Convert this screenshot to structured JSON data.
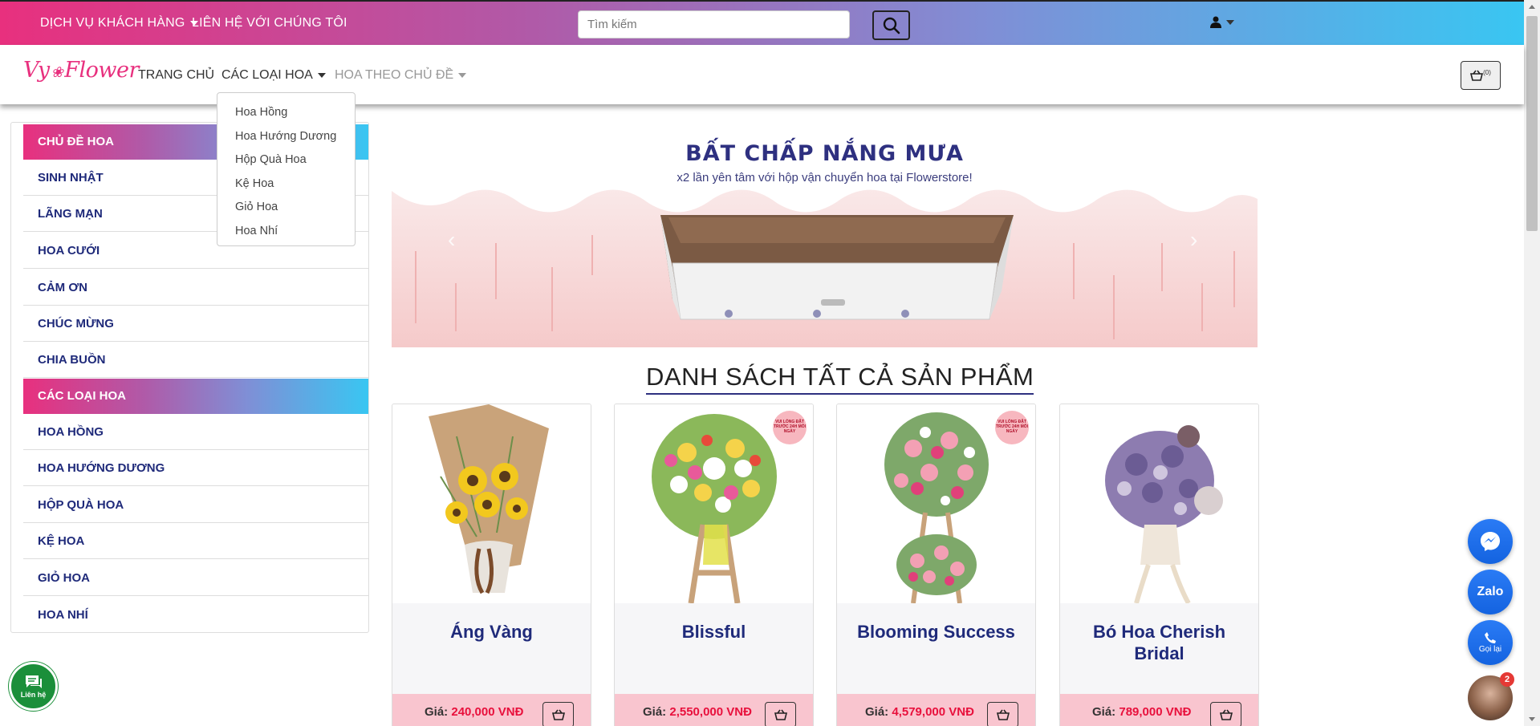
{
  "topbar": {
    "customer_service": "DỊCH VỤ KHÁCH HÀNG",
    "contact_us": "LIÊN HỆ VỚI CHÚNG TÔI",
    "search_placeholder": "Tìm kiếm"
  },
  "nav": {
    "logo_left": "Vy",
    "logo_right": "Flower",
    "home": "TRANG CHỦ",
    "flower_types": "CÁC LOẠI HOA",
    "by_topic": "HOA THEO CHỦ ĐỀ",
    "cart_count": "(0)"
  },
  "dropdown": {
    "items": [
      "Hoa Hồng",
      "Hoa Hướng Dương",
      "Hộp Quà Hoa",
      "Kệ Hoa",
      "Giỏ Hoa",
      "Hoa Nhí"
    ]
  },
  "sidebar": {
    "topics_header": "CHỦ ĐỀ HOA",
    "topics": [
      "SINH NHẬT",
      "LÃNG MẠN",
      "HOA CƯỚI",
      "CẢM ƠN",
      "CHÚC MỪNG",
      "CHIA BUỒN"
    ],
    "types_header": "CÁC LOẠI HOA",
    "types": [
      "HOA HỒNG",
      "HOA HƯỚNG DƯƠNG",
      "HỘP QUÀ HOA",
      "KỆ HOA",
      "GIỎ HOA",
      "HOA NHÍ"
    ]
  },
  "banner": {
    "title": "BẤT CHẤP NẮNG MƯA",
    "subtitle": "x2 lần yên tâm với hộp vận chuyển hoa tại Flowerstore!"
  },
  "section_title": "DANH SÁCH TẤT CẢ SẢN PHẨM",
  "products": [
    {
      "name": "Áng Vàng",
      "price_label": "Giá:",
      "price": "240,000 VNĐ"
    },
    {
      "name": "Blissful",
      "price_label": "Giá:",
      "price": "2,550,000 VNĐ",
      "badge": "VUI LÒNG ĐẶT TRƯỚC 24H MỖI NGÀY"
    },
    {
      "name": "Blooming Success",
      "price_label": "Giá:",
      "price": "4,579,000 VNĐ",
      "badge": "VUI LÒNG ĐẶT TRƯỚC 24H MỖI NGÀY"
    },
    {
      "name": "Bó Hoa Cherish Bridal",
      "price_label": "Giá:",
      "price": "789,000 VNĐ"
    }
  ],
  "floating": {
    "zalo": "Zalo",
    "call": "Gọi lại",
    "chat_badge": "2",
    "contact": "Liên hệ"
  },
  "colors": {
    "gradient_start": "#e8307e",
    "gradient_end": "#39c6f2",
    "navy": "#1f2a7a",
    "price_red": "#e8103c",
    "price_bg": "#f9c5cf"
  }
}
